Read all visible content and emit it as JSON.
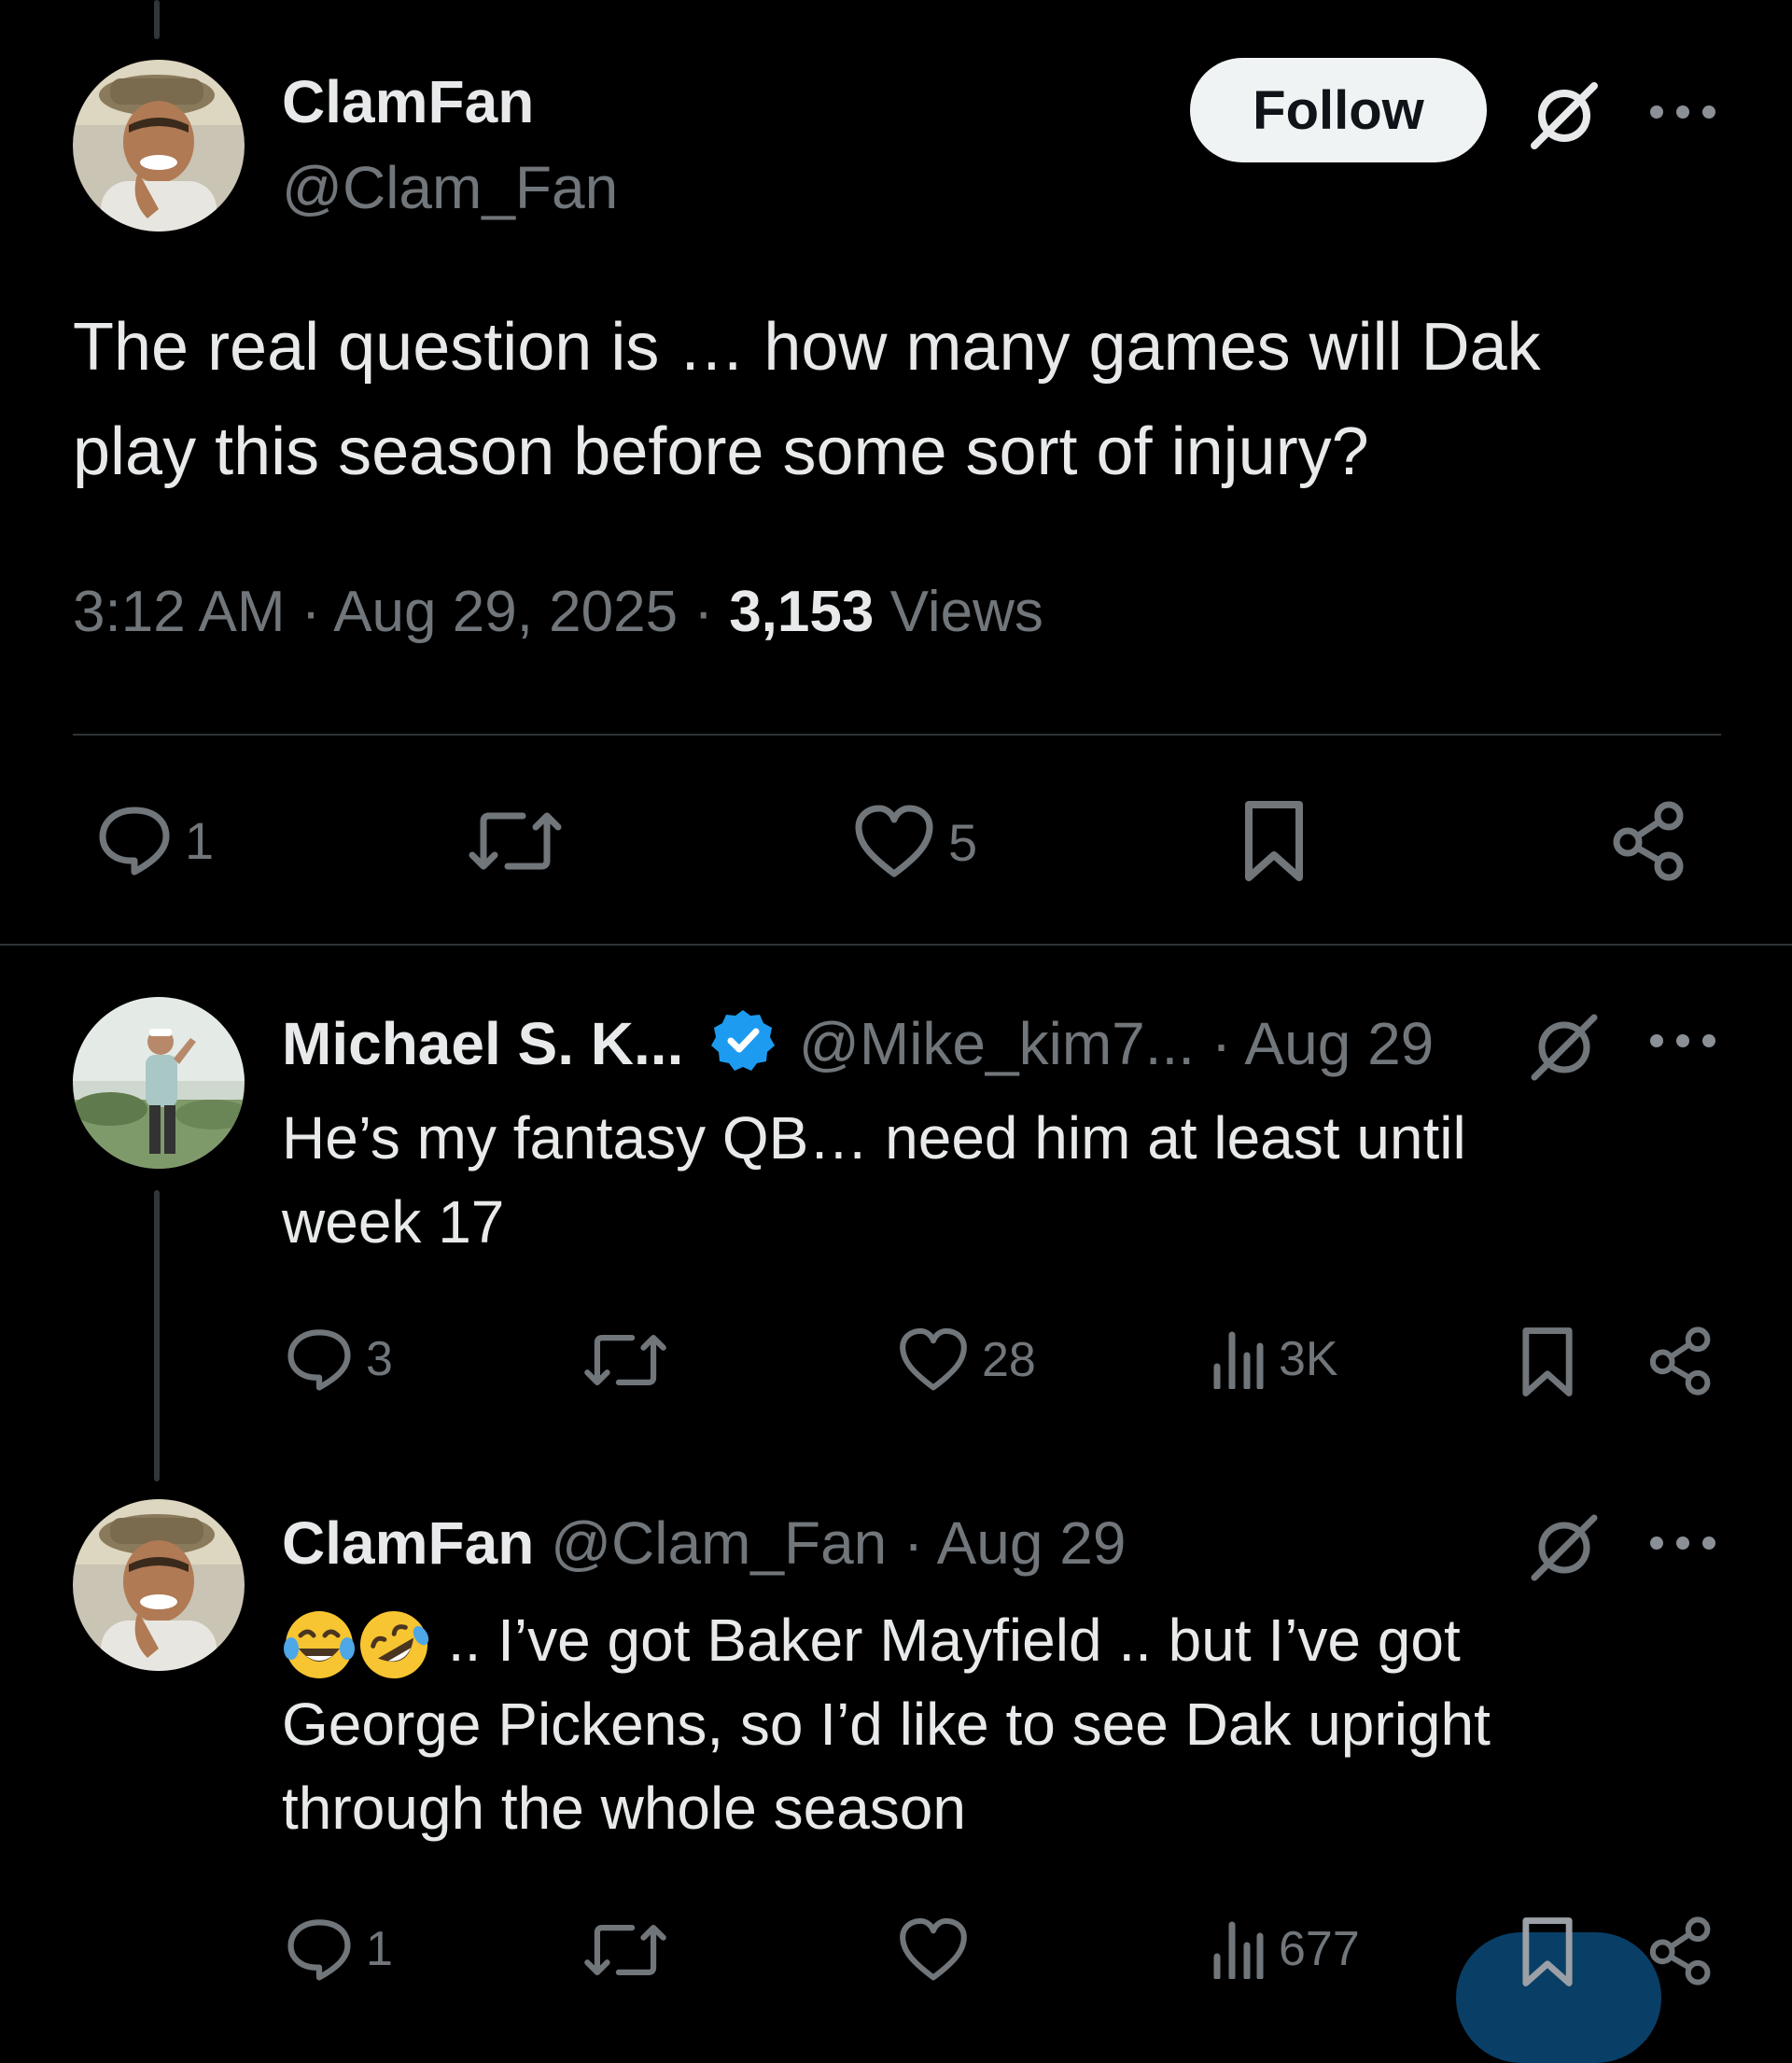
{
  "main_post": {
    "author_name": "ClamFan",
    "author_handle": "@Clam_Fan",
    "follow_label": "Follow",
    "text_line1": "The real question is … how many games will Dak",
    "text_line2": "play this season before some sort of injury?",
    "time": "3:12 AM",
    "sep1": "·",
    "date": "Aug 29, 2025",
    "sep2": "·",
    "views_count": "3,153",
    "views_label": "Views",
    "replies": "1",
    "likes": "5"
  },
  "replies": [
    {
      "author_name": "Michael S. K...",
      "author_handle": "@Mike_kim7...",
      "sep": "·",
      "date": "Aug 29",
      "text_line1": "He’s my fantasy QB… need him at least until",
      "text_line2": "week 17",
      "replies": "3",
      "likes": "28",
      "views": "3K"
    },
    {
      "author_name": "ClamFan",
      "author_handle": "@Clam_Fan",
      "sep": "·",
      "date": "Aug 29",
      "text_line1": ".. I’ve got Baker Mayfield .. but I’ve got",
      "text_line2": "George Pickens, so I’d like to see Dak upright",
      "text_line3": "through the whole season",
      "replies": "1",
      "views": "677"
    }
  ],
  "colors": {
    "background": "#000000",
    "text": "#e7e9ea",
    "muted": "#71767b",
    "divider": "#2f3336",
    "verified": "#1d9bf0"
  }
}
